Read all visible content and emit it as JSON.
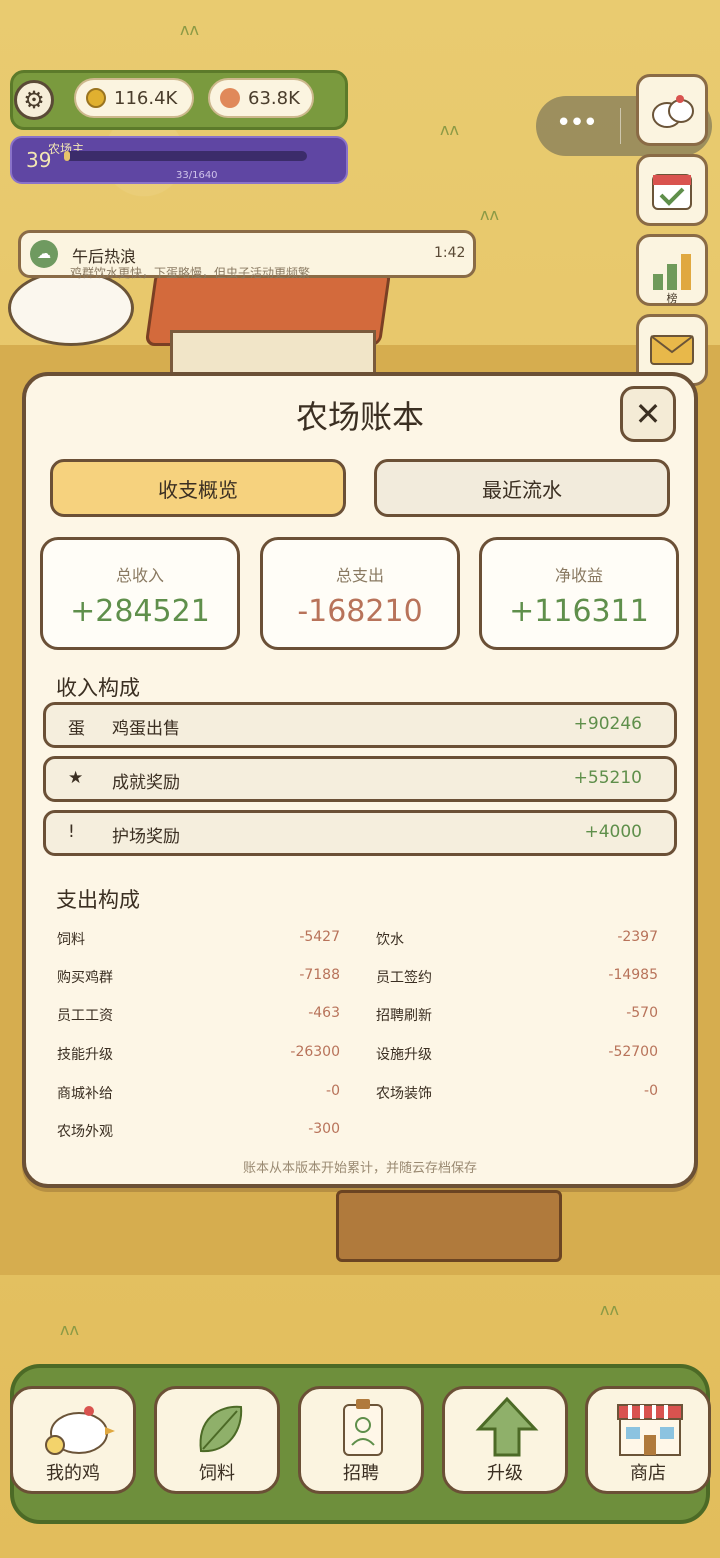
{
  "hud": {
    "gold": "116.4K",
    "seeds": "63.8K",
    "level": "39",
    "title": "农场主",
    "exp_text": "33/1640",
    "exp_fraction": 0.02,
    "colors": {
      "gold": "#e0b030",
      "seeds": "#e0895a"
    }
  },
  "capsule": {
    "menu_icon": "more-dots-icon",
    "target_icon": "record-target-icon"
  },
  "side_buttons": [
    {
      "icon": "chicken-group-icon"
    },
    {
      "icon": "calendar-check-icon"
    },
    {
      "icon": "leaderboard-icon",
      "label": "榜"
    },
    {
      "icon": "mail-icon"
    }
  ],
  "event": {
    "title": "午后热浪",
    "time": "1:42",
    "subtitle": "鸡群饮水更快，下蛋略慢，但虫子活动更频繁",
    "icon": "cloud-icon"
  },
  "modal": {
    "title": "农场账本",
    "close_icon": "close-icon",
    "tabs": [
      {
        "label": "收支概览",
        "active": true
      },
      {
        "label": "最近流水",
        "active": false
      }
    ],
    "stats": [
      {
        "label": "总收入",
        "value": "+284521",
        "color": "#5f8f4b"
      },
      {
        "label": "总支出",
        "value": "-168210",
        "color": "#b8735a"
      },
      {
        "label": "净收益",
        "value": "+116311",
        "color": "#5f8f4b"
      }
    ],
    "income_title": "收入构成",
    "income": [
      {
        "icon": "蛋",
        "label": "鸡蛋出售",
        "value": "+90246"
      },
      {
        "icon": "★",
        "label": "成就奖励",
        "value": "+55210"
      },
      {
        "icon": "!",
        "label": "护场奖励",
        "value": "+4000"
      }
    ],
    "expense_title": "支出构成",
    "expenses": [
      {
        "label": "饲料",
        "value": "-5427"
      },
      {
        "label": "饮水",
        "value": "-2397"
      },
      {
        "label": "购买鸡群",
        "value": "-7188"
      },
      {
        "label": "员工签约",
        "value": "-14985"
      },
      {
        "label": "员工工资",
        "value": "-463"
      },
      {
        "label": "招聘刷新",
        "value": "-570"
      },
      {
        "label": "技能升级",
        "value": "-26300"
      },
      {
        "label": "设施升级",
        "value": "-52700"
      },
      {
        "label": "商城补给",
        "value": "-0"
      },
      {
        "label": "农场装饰",
        "value": "-0"
      },
      {
        "label": "农场外观",
        "value": "-300"
      }
    ],
    "footnote": "账本从本版本开始累计，并随云存档保存"
  },
  "nav": [
    {
      "label": "我的鸡",
      "icon": "chicken-icon"
    },
    {
      "label": "饲料",
      "icon": "leaf-icon"
    },
    {
      "label": "招聘",
      "icon": "id-badge-icon"
    },
    {
      "label": "升级",
      "icon": "up-arrow-icon"
    },
    {
      "label": "商店",
      "icon": "shop-icon"
    }
  ]
}
